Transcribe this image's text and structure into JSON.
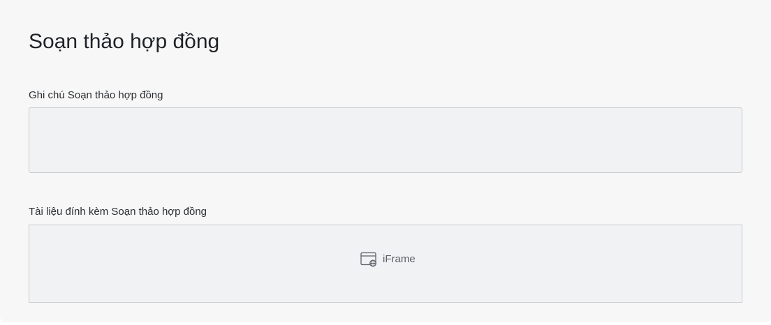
{
  "page": {
    "title": "Soạn thảo hợp đồng"
  },
  "note_field": {
    "label": "Ghi chú Soạn thảo hợp đồng",
    "value": "",
    "placeholder": ""
  },
  "attachment_field": {
    "label": "Tài liệu đính kèm Soạn thảo hợp đồng",
    "embed_label": "iFrame",
    "embed_icon": "iframe-globe-icon"
  },
  "colors": {
    "background": "#f7f7f7",
    "field_background": "#f1f2f4",
    "field_border": "#c8cace",
    "text": "#1f2328",
    "muted_text": "#5a6068"
  }
}
